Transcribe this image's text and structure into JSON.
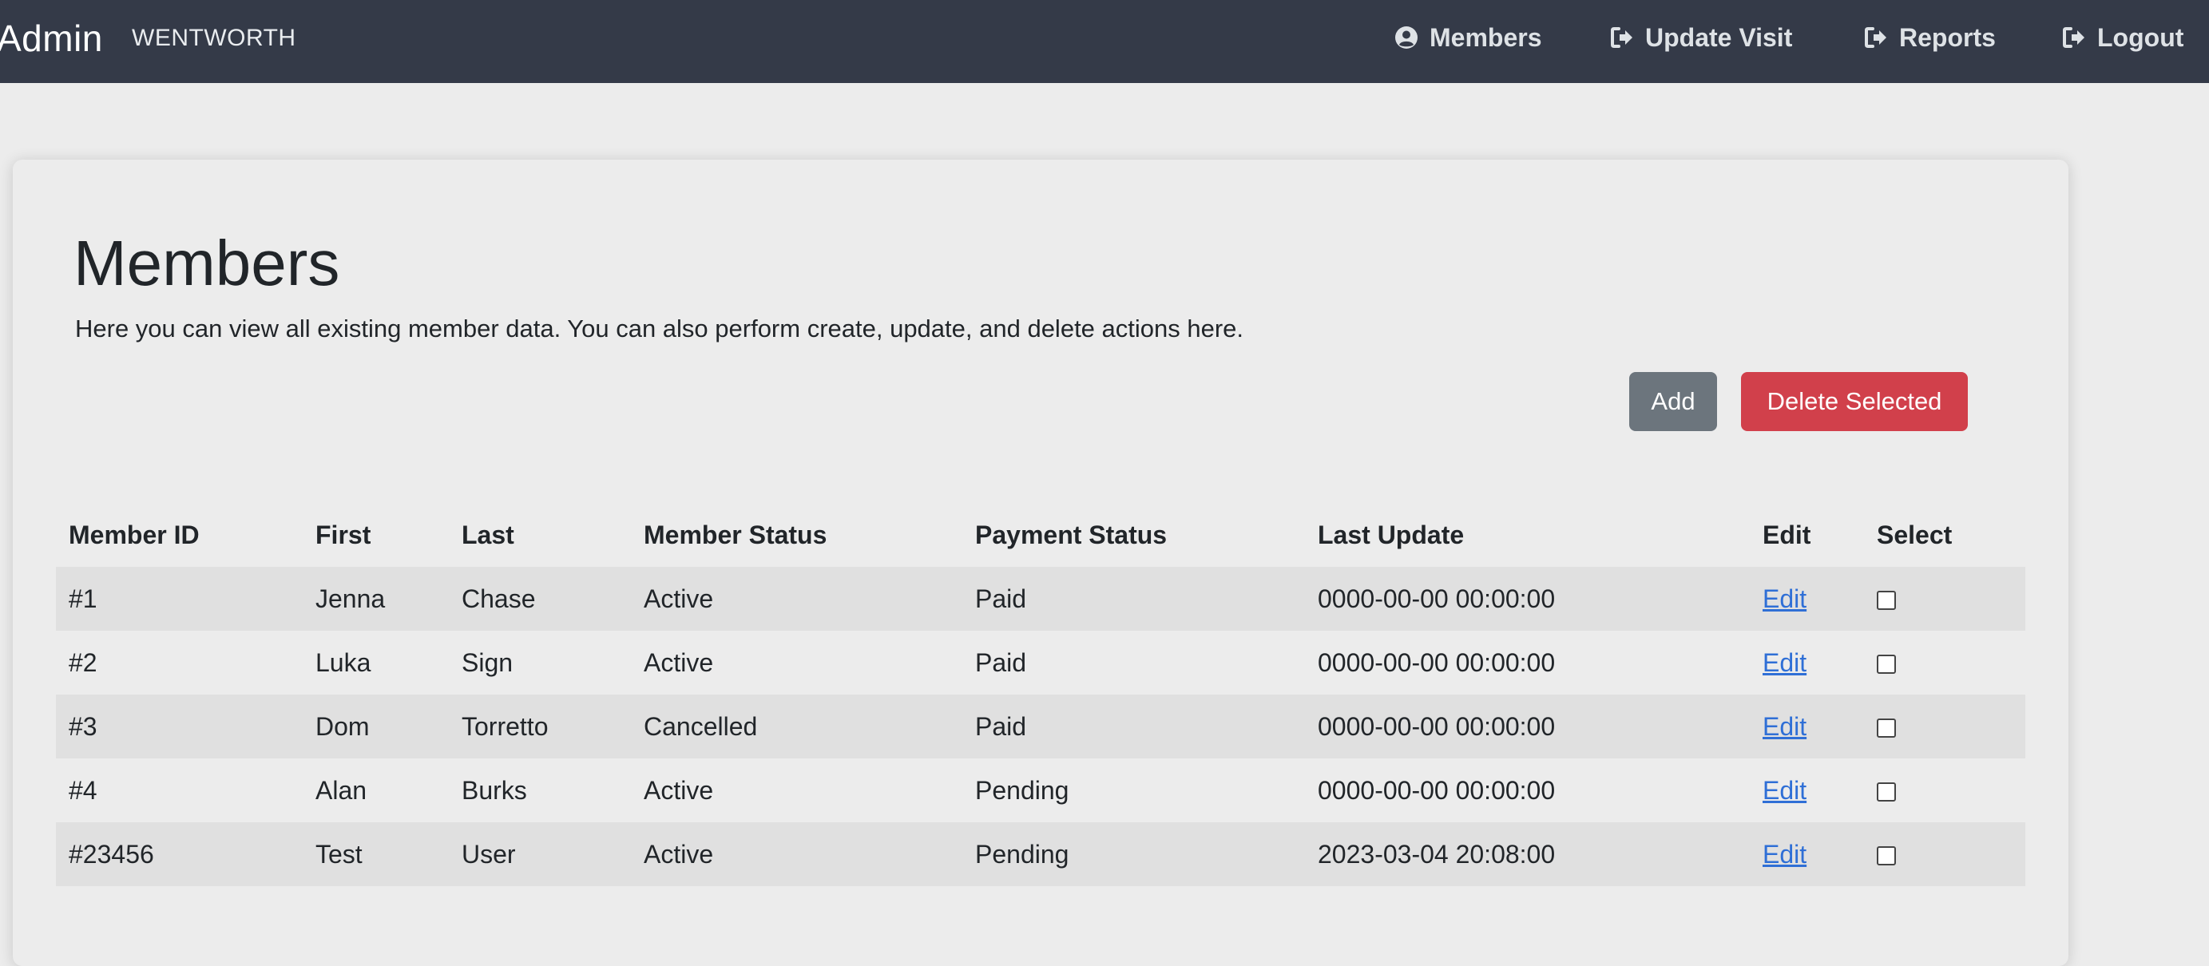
{
  "navbar": {
    "brand": "Admin",
    "site_name": "WENTWORTH",
    "items": [
      {
        "label": "Members",
        "icon": "user-circle-icon"
      },
      {
        "label": "Update Visit",
        "icon": "sign-out-arrow-icon"
      },
      {
        "label": "Reports",
        "icon": "sign-out-arrow-icon"
      },
      {
        "label": "Logout",
        "icon": "sign-out-arrow-icon"
      }
    ]
  },
  "page": {
    "title": "Members",
    "description": "Here you can view all existing member data. You can also perform create, update, and delete actions here.",
    "add_label": "Add",
    "delete_label": "Delete Selected"
  },
  "colors": {
    "navbar": "#343a48",
    "status_active": "#2e8b4a",
    "status_cancelled": "#d33a45",
    "button_add": "#6c757d",
    "button_delete": "#d1404b",
    "link": "#2f6fd6"
  },
  "table": {
    "headers": [
      "Member ID",
      "First",
      "Last",
      "Member Status",
      "Payment Status",
      "Last Update",
      "Edit",
      "Select"
    ],
    "rows": [
      {
        "id": "#1",
        "first": "Jenna",
        "last": "Chase",
        "member_status": "Active",
        "payment_status": "Paid",
        "last_update": "0000-00-00 00:00:00",
        "edit": "Edit",
        "selected": false
      },
      {
        "id": "#2",
        "first": "Luka",
        "last": "Sign",
        "member_status": "Active",
        "payment_status": "Paid",
        "last_update": "0000-00-00 00:00:00",
        "edit": "Edit",
        "selected": false
      },
      {
        "id": "#3",
        "first": "Dom",
        "last": "Torretto",
        "member_status": "Cancelled",
        "payment_status": "Paid",
        "last_update": "0000-00-00 00:00:00",
        "edit": "Edit",
        "selected": false
      },
      {
        "id": "#4",
        "first": "Alan",
        "last": "Burks",
        "member_status": "Active",
        "payment_status": "Pending",
        "last_update": "0000-00-00 00:00:00",
        "edit": "Edit",
        "selected": false
      },
      {
        "id": "#23456",
        "first": "Test",
        "last": "User",
        "member_status": "Active",
        "payment_status": "Pending",
        "last_update": "2023-03-04 20:08:00",
        "edit": "Edit",
        "selected": false
      }
    ]
  }
}
